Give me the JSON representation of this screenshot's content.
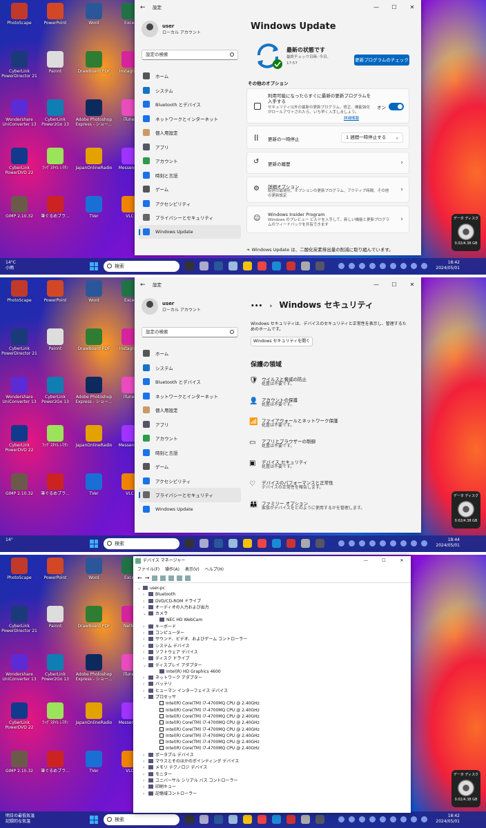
{
  "desktop_icons": [
    {
      "label": "PhotoScape",
      "color": "#c0392b"
    },
    {
      "label": "PowerPoint",
      "color": "#d24726"
    },
    {
      "label": "Word",
      "color": "#2b579a"
    },
    {
      "label": "Excel",
      "color": "#217346"
    },
    {
      "label": "CyberLink PowerDirector 21",
      "color": "#1b3a7a"
    },
    {
      "label": "Painnt",
      "color": "#ddd"
    },
    {
      "label": "DrawBoard PDF",
      "color": "#2f7d32"
    },
    {
      "label": "Instagram",
      "color": "#d6249f"
    },
    {
      "label": "Wondershare UniConverter 13",
      "color": "#5b2bd6"
    },
    {
      "label": "CyberLink Power2Go 13",
      "color": "#0f7eb3"
    },
    {
      "label": "Adobe Photoshop Express - ショー...",
      "color": "#0c2a5c"
    },
    {
      "label": "iTunes",
      "color": "#ea4cc0"
    },
    {
      "label": "CyberLink PowerDVD 22",
      "color": "#123a8c"
    },
    {
      "label": "ﾗｯｸﾞｽﾀｲﾙ ﾚﾏﾀﾝ",
      "color": "#9be35a"
    },
    {
      "label": "JapanOnlineRadio",
      "color": "#e4a200"
    },
    {
      "label": "Messenger",
      "color": "#a033ff"
    },
    {
      "label": "GIMP 2.10.32",
      "color": "#6b5a4a"
    },
    {
      "label": "筆ぐるめプラ...",
      "color": "#c22"
    },
    {
      "label": "TVer",
      "color": "#1a6fd6"
    },
    {
      "label": "VLC",
      "color": "#f08400"
    }
  ],
  "desktop_icons_row2_s1": [
    "Instagram"
  ],
  "dm_desktop_icons": [
    {
      "label": "PhotoScape",
      "color": "#c0392b"
    },
    {
      "label": "PowerPoint",
      "color": "#d24726"
    },
    {
      "label": "Word",
      "color": "#2b579a"
    },
    {
      "label": "Excel",
      "color": "#217346"
    },
    {
      "label": "CyberLink PowerDirector 21",
      "color": "#1b3a7a"
    },
    {
      "label": "Painnt",
      "color": "#ddd"
    },
    {
      "label": "DrawBoard PDF",
      "color": "#2f7d32"
    },
    {
      "label": "Netbg",
      "color": "#d6249f"
    },
    {
      "label": "Wondershare UniConverter 13",
      "color": "#5b2bd6"
    },
    {
      "label": "CyberLink Power2Go 13",
      "color": "#0f7eb3"
    },
    {
      "label": "Adobe Photoshop Express - ショー...",
      "color": "#0c2a5c"
    },
    {
      "label": "iTunes",
      "color": "#ea4cc0"
    },
    {
      "label": "CyberLink PowerDVD 22",
      "color": "#123a8c"
    },
    {
      "label": "ﾗｯｸﾞｽﾀｲﾙ ﾚﾏﾀﾝ",
      "color": "#9be35a"
    },
    {
      "label": "JapanOnlineRadio",
      "color": "#e4a200"
    },
    {
      "label": "Messenger",
      "color": "#a033ff"
    },
    {
      "label": "GIMP 2.10.32",
      "color": "#6b5a4a"
    },
    {
      "label": "筆ぐるめプラ...",
      "color": "#c22"
    },
    {
      "label": "TVer",
      "color": "#1a6fd6"
    },
    {
      "label": "VLC",
      "color": "#f08400"
    }
  ],
  "taskbar": {
    "s1": {
      "weather_temp": "14°C",
      "weather_desc": "小雨",
      "search": "検索",
      "time": "18:42",
      "date": "2024/05/01"
    },
    "s2": {
      "weather_temp": "14°",
      "weather_desc": "",
      "search": "検索",
      "time": "18:44",
      "date": "2024/05/01"
    },
    "s3": {
      "weather_temp": "明日の最低気温",
      "weather_desc": "記録的な気温",
      "search": "検索",
      "time": "18:42",
      "date": "2024/05/01"
    }
  },
  "widget": {
    "title": "データ ディスク",
    "size": "0.02/4.38 GB",
    "brand": "CyberLink"
  },
  "settings": {
    "title": "設定",
    "user_name": "user",
    "user_sub": "ローカル アカウント",
    "search_placeholder": "設定の検索",
    "nav": [
      "ホーム",
      "システム",
      "Bluetooth とデバイス",
      "ネットワークとインターネット",
      "個人用設定",
      "アプリ",
      "アカウント",
      "時刻と言語",
      "ゲーム",
      "アクセシビリティ",
      "プライバシーとセキュリティ",
      "Windows Update"
    ],
    "nav_colors": [
      "#555",
      "#1673c6",
      "#1a73e8",
      "#1a73e8",
      "#c96",
      "#556",
      "#2d9b4b",
      "#1a73e8",
      "#555",
      "#1a73e8",
      "#666",
      "#1a73e8"
    ]
  },
  "update": {
    "heading": "Windows Update",
    "status": "最新の状態です",
    "last_check": "最終チェック日時: 今日、",
    "last_time": "17:57",
    "check_button": "更新プログラムのチェック",
    "other_options": "その他のオプション",
    "opt1_title": "利用可能になったらすぐに最新の更新プログラムを入手する",
    "opt1_desc": "セキュリティ以外の最新の更新プログラム、修正、機能強化がロールアウトされたら、いち早く入手しましょう。",
    "opt1_link": "詳細情報",
    "opt1_state": "オン",
    "pause_label": "更新の一時停止",
    "pause_value": "1 週間一時停止する",
    "history": "更新の履歴",
    "adv_title": "詳細オプション",
    "adv_desc": "配信の最適化、オプションの更新プログラム、アクティブ時間、その他の更新設定",
    "insider_title": "Windows Insider Program",
    "insider_desc": "Windows のプレビュー ビルドを入手して、新しい機能と更新プログラムのフィードバックを共有できます",
    "footer": "Windows Update は、二酸化炭素排出量の削減に取り組んでいます。"
  },
  "security": {
    "breadcrumb": "•••",
    "heading": "Windows セキュリティ",
    "desc": "Windows セキュリティは、デバイスのセキュリティと正常性を表示し、管理するためのホームです。",
    "open_button": "Windows セキュリティを開く",
    "areas_title": "保護の領域",
    "areas": [
      {
        "title": "ウイルスと脅威の防止",
        "status": "処置は不要です。"
      },
      {
        "title": "アカウントの保護",
        "status": "処置は不要です。"
      },
      {
        "title": "ファイアウォールとネットワーク保護",
        "status": "処置は不要です。"
      },
      {
        "title": "アプリとブラウザーの制御",
        "status": "処置は不要です。"
      },
      {
        "title": "デバイス セキュリティ",
        "status": "処置は不要です。"
      },
      {
        "title": "デバイスのパフォーマンスと正常性",
        "status": "デバイスの正常性を報告します。"
      },
      {
        "title": "ファミリー オプション",
        "status": "家族がデバイスをどのように使用するかを管理します。"
      }
    ]
  },
  "devmgr": {
    "title": "デバイス マネージャー",
    "menu": [
      "ファイル(F)",
      "操作(A)",
      "表示(V)",
      "ヘルプ(H)"
    ],
    "root": "user-pc",
    "rows": [
      {
        "t": "Bluetooth",
        "lvl": 1,
        "ex": "›"
      },
      {
        "t": "DVD/CD-ROM ドライブ",
        "lvl": 1,
        "ex": "›"
      },
      {
        "t": "オーディオの入力および出力",
        "lvl": 1,
        "ex": "›"
      },
      {
        "t": "カメラ",
        "lvl": 1,
        "ex": "⌄"
      },
      {
        "t": "NEC HD WebCam",
        "lvl": 2,
        "ex": ""
      },
      {
        "t": "キーボード",
        "lvl": 1,
        "ex": "›"
      },
      {
        "t": "コンピューター",
        "lvl": 1,
        "ex": "›"
      },
      {
        "t": "サウンド、ビデオ、およびゲーム コントローラー",
        "lvl": 1,
        "ex": "›"
      },
      {
        "t": "システム デバイス",
        "lvl": 1,
        "ex": "›"
      },
      {
        "t": "ソフトウェア デバイス",
        "lvl": 1,
        "ex": "›"
      },
      {
        "t": "ディスク ドライブ",
        "lvl": 1,
        "ex": "›"
      },
      {
        "t": "ディスプレイ アダプター",
        "lvl": 1,
        "ex": "⌄"
      },
      {
        "t": "Intel(R) HD Graphics 4600",
        "lvl": 2,
        "ex": ""
      },
      {
        "t": "ネットワーク アダプター",
        "lvl": 1,
        "ex": "›"
      },
      {
        "t": "バッテリ",
        "lvl": 1,
        "ex": "›"
      },
      {
        "t": "ヒューマン インターフェイス デバイス",
        "lvl": 1,
        "ex": "›"
      },
      {
        "t": "プロセッサ",
        "lvl": 1,
        "ex": "⌄"
      },
      {
        "t": "Intel(R) Core(TM) i7-4700MQ CPU @ 2.40GHz",
        "lvl": 2,
        "ex": "",
        "p": 1
      },
      {
        "t": "Intel(R) Core(TM) i7-4700MQ CPU @ 2.40GHz",
        "lvl": 2,
        "ex": "",
        "p": 1
      },
      {
        "t": "Intel(R) Core(TM) i7-4700MQ CPU @ 2.40GHz",
        "lvl": 2,
        "ex": "",
        "p": 1
      },
      {
        "t": "Intel(R) Core(TM) i7-4700MQ CPU @ 2.40GHz",
        "lvl": 2,
        "ex": "",
        "p": 1
      },
      {
        "t": "Intel(R) Core(TM) i7-4700MQ CPU @ 2.40GHz",
        "lvl": 2,
        "ex": "",
        "p": 1
      },
      {
        "t": "Intel(R) Core(TM) i7-4700MQ CPU @ 2.40GHz",
        "lvl": 2,
        "ex": "",
        "p": 1
      },
      {
        "t": "Intel(R) Core(TM) i7-4700MQ CPU @ 2.40GHz",
        "lvl": 2,
        "ex": "",
        "p": 1
      },
      {
        "t": "Intel(R) Core(TM) i7-4700MQ CPU @ 2.40GHz",
        "lvl": 2,
        "ex": "",
        "p": 1
      },
      {
        "t": "ポータブル デバイス",
        "lvl": 1,
        "ex": "›"
      },
      {
        "t": "マウスとそのほかのポインティング デバイス",
        "lvl": 1,
        "ex": "›"
      },
      {
        "t": "メモリ テクノロジ デバイス",
        "lvl": 1,
        "ex": "›"
      },
      {
        "t": "モニター",
        "lvl": 1,
        "ex": "›"
      },
      {
        "t": "ユニバーサル シリアル バス コントローラー",
        "lvl": 1,
        "ex": "›"
      },
      {
        "t": "印刷キュー",
        "lvl": 1,
        "ex": "›"
      },
      {
        "t": "記憶域コントローラー",
        "lvl": 1,
        "ex": "›"
      }
    ]
  }
}
